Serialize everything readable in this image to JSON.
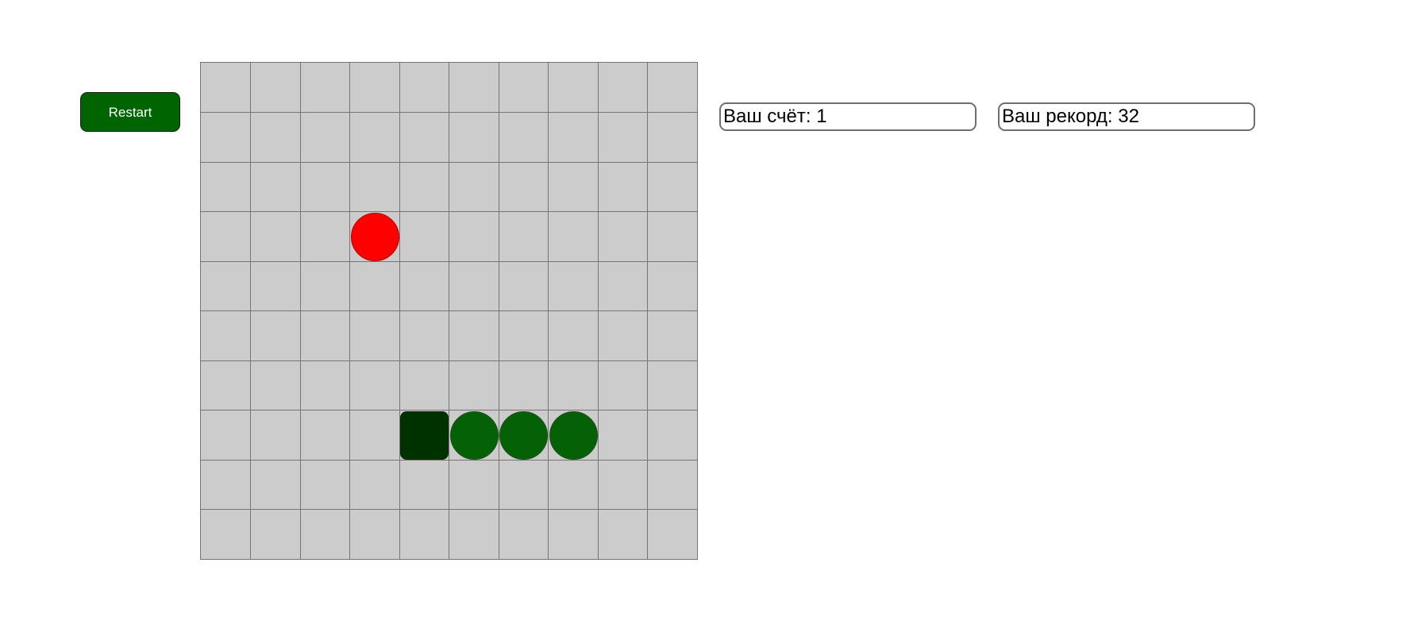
{
  "restart_button": {
    "label": "Restart"
  },
  "score": {
    "label": "Ваш счёт: 1"
  },
  "record": {
    "label": "Ваш рекорд: 32"
  },
  "board": {
    "columns": 10,
    "rows": 10,
    "food": {
      "col": 3,
      "row": 3
    },
    "snake": {
      "head": {
        "col": 4,
        "row": 7
      },
      "body": [
        {
          "col": 5,
          "row": 7
        },
        {
          "col": 6,
          "row": 7
        },
        {
          "col": 7,
          "row": 7
        }
      ]
    }
  },
  "colors": {
    "button": "#006400",
    "cell": "#cccccc",
    "grid_line": "#7a7373",
    "food": "#ff0000",
    "snake_head": "#003200",
    "snake_body": "#056105"
  }
}
